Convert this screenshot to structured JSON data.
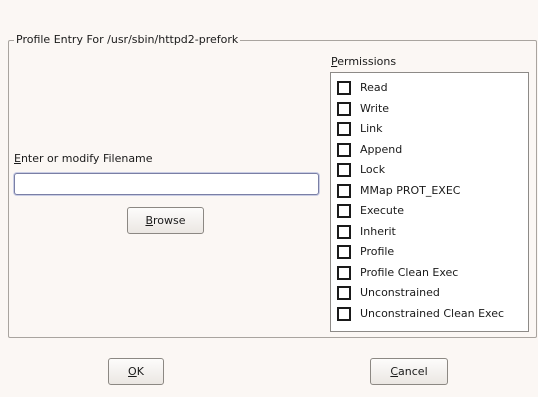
{
  "dialog": {
    "frame_title": "Profile Entry For /usr/sbin/httpd2-prefork",
    "filename": {
      "label_mnemonic": "E",
      "label_rest": "nter or modify Filename",
      "value": ""
    },
    "browse": {
      "mnemonic": "B",
      "rest": "rowse"
    },
    "permissions": {
      "label_mnemonic": "P",
      "label_rest": "ermissions",
      "items": [
        {
          "label": "Read",
          "checked": false
        },
        {
          "label": "Write",
          "checked": false
        },
        {
          "label": "Link",
          "checked": false
        },
        {
          "label": "Append",
          "checked": false
        },
        {
          "label": "Lock",
          "checked": false
        },
        {
          "label": "MMap PROT_EXEC",
          "checked": false
        },
        {
          "label": "Execute",
          "checked": false
        },
        {
          "label": "Inherit",
          "checked": false
        },
        {
          "label": "Profile",
          "checked": false
        },
        {
          "label": "Profile Clean Exec",
          "checked": false
        },
        {
          "label": "Unconstrained",
          "checked": false
        },
        {
          "label": "Unconstrained Clean Exec",
          "checked": false
        }
      ]
    },
    "ok": {
      "mnemonic": "O",
      "rest": "K"
    },
    "cancel": {
      "mnemonic": "C",
      "rest": "ancel"
    }
  }
}
